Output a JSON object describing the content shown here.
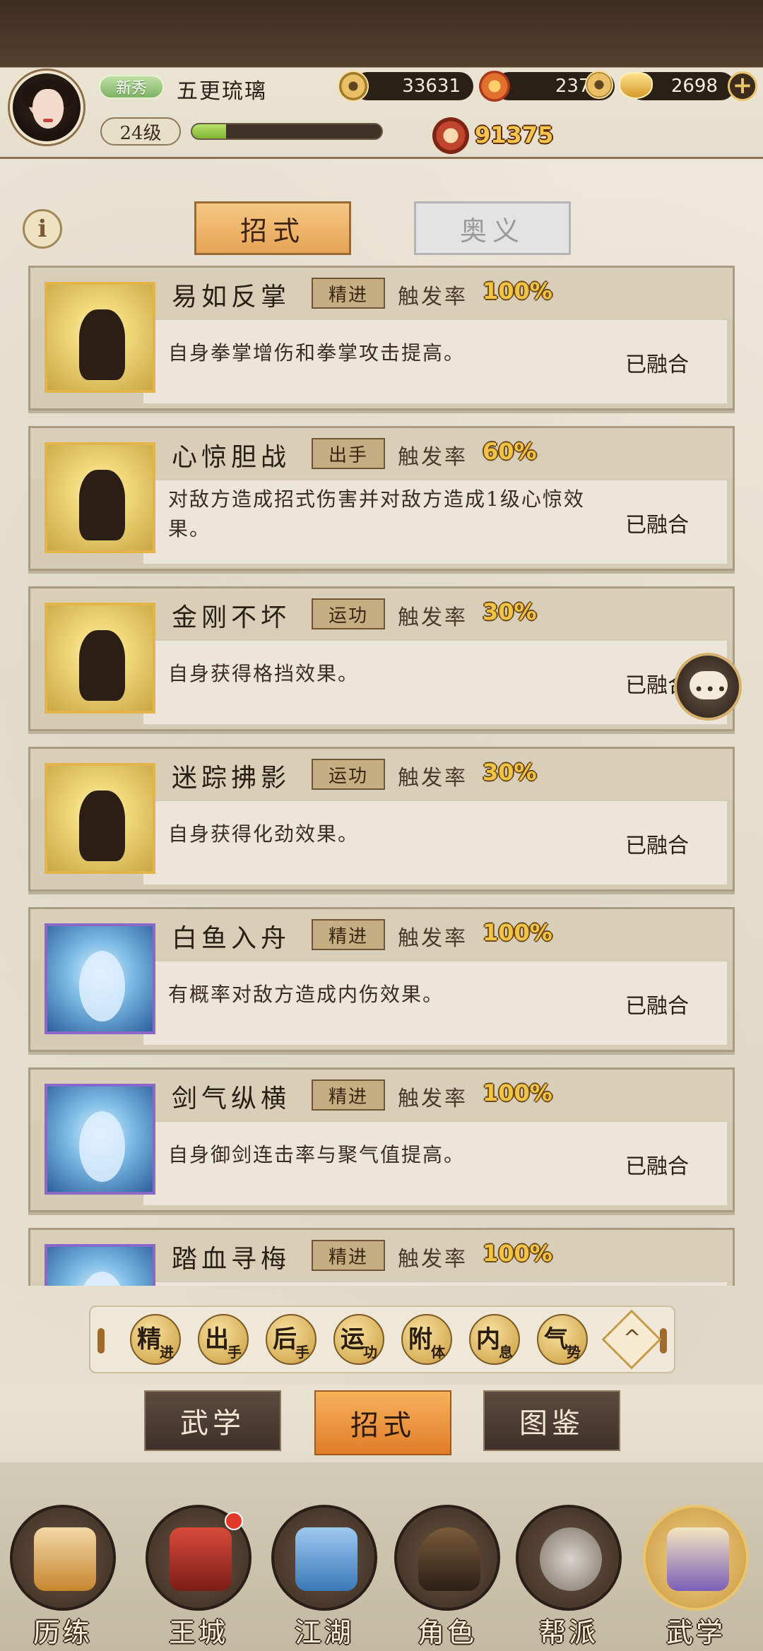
{
  "header": {
    "rank_badge": "新秀",
    "player_name": "五更琉璃",
    "level": "24级",
    "exp_fraction": 0.18,
    "currencies": [
      {
        "icon": "copper-coin-icon",
        "value": "33631"
      },
      {
        "icon": "fire-gem-icon",
        "value": "2370"
      },
      {
        "icon": "gold-ingot-icon",
        "value": "2698"
      }
    ],
    "power_icon": "combat-power-icon",
    "power_value": "91375"
  },
  "tabs": {
    "info_icon": "i",
    "active": "招式",
    "inactive": "奥义"
  },
  "skills": [
    {
      "name": "易如反掌",
      "type": "精进",
      "rate_label": "触发率",
      "rate": "100%",
      "desc": "自身拳掌增伤和拳掌攻击提高。",
      "status": "已融合",
      "frame": "gold"
    },
    {
      "name": "心惊胆战",
      "type": "出手",
      "rate_label": "触发率",
      "rate": "60%",
      "desc": "对敌方造成招式伤害并对敌方造成1级心惊效果。",
      "status": "已融合",
      "frame": "gold"
    },
    {
      "name": "金刚不坏",
      "type": "运功",
      "rate_label": "触发率",
      "rate": "30%",
      "desc": "自身获得格挡效果。",
      "status": "已融合",
      "frame": "gold"
    },
    {
      "name": "迷踪拂影",
      "type": "运功",
      "rate_label": "触发率",
      "rate": "30%",
      "desc": "自身获得化劲效果。",
      "status": "已融合",
      "frame": "gold"
    },
    {
      "name": "白鱼入舟",
      "type": "精进",
      "rate_label": "触发率",
      "rate": "100%",
      "desc": "有概率对敌方造成内伤效果。",
      "status": "已融合",
      "frame": "blue"
    },
    {
      "name": "剑气纵横",
      "type": "精进",
      "rate_label": "触发率",
      "rate": "100%",
      "desc": "自身御剑连击率与聚气值提高。",
      "status": "已融合",
      "frame": "blue"
    },
    {
      "name": "踏血寻梅",
      "type": "精进",
      "rate_label": "触发率",
      "rate": "100%",
      "desc": "",
      "status": "",
      "frame": "blue"
    }
  ],
  "filters": [
    {
      "big": "精",
      "small": "进"
    },
    {
      "big": "出",
      "small": "手"
    },
    {
      "big": "后",
      "small": "手"
    },
    {
      "big": "运",
      "small": "功"
    },
    {
      "big": "附",
      "small": "体"
    },
    {
      "big": "内",
      "small": "息"
    },
    {
      "big": "气",
      "small": "势"
    }
  ],
  "filter_expand_icon": "^",
  "chat_icon": "chat-bubble-icon",
  "sub_tabs": [
    "武学",
    "招式",
    "图鉴"
  ],
  "nav": [
    {
      "label": "历练",
      "icon": "training-icon"
    },
    {
      "label": "王城",
      "icon": "palace-icon"
    },
    {
      "label": "江湖",
      "icon": "sword-world-icon"
    },
    {
      "label": "角色",
      "icon": "character-icon"
    },
    {
      "label": "帮派",
      "icon": "guild-icon"
    },
    {
      "label": "武学",
      "icon": "scroll-icon"
    }
  ],
  "colors": {
    "accent": "#e6a457",
    "rate_gold": "#f2c445",
    "panel": "#d6ccb6"
  }
}
